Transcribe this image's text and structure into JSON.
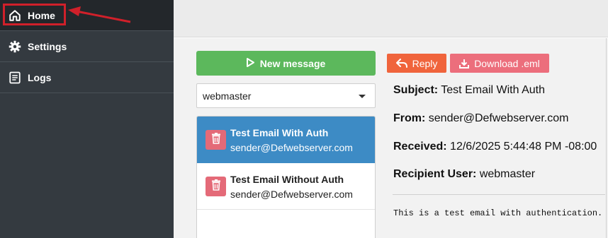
{
  "sidebar": {
    "items": [
      {
        "label": "Home",
        "icon": "home-icon"
      },
      {
        "label": "Settings",
        "icon": "gear-icon"
      },
      {
        "label": "Logs",
        "icon": "log-icon"
      }
    ]
  },
  "toolbar": {
    "new_message_label": "New message",
    "reply_label": "Reply",
    "download_label": "Download .eml"
  },
  "user_select": {
    "selected": "webmaster"
  },
  "messages": [
    {
      "subject": "Test Email With Auth",
      "from": "sender@Defwebserver.com",
      "selected": true
    },
    {
      "subject": "Test Email Without Auth",
      "from": "sender@Defwebserver.com",
      "selected": false
    }
  ],
  "detail": {
    "subject_label": "Subject:",
    "subject": "Test Email With Auth",
    "from_label": "From:",
    "from": "sender@Defwebserver.com",
    "received_label": "Received:",
    "received": "12/6/2025 5:44:48 PM -08:00",
    "recipient_label": "Recipient User:",
    "recipient": "webmaster",
    "body": "This is a test email with authentication."
  },
  "colors": {
    "sidebar": "#343a40",
    "new_message": "#5cb85c",
    "selected_item": "#3d8bc5",
    "reply": "#f0643c",
    "download": "#ec6e7c",
    "delete": "#e46a78",
    "annotation": "#d0202a"
  }
}
